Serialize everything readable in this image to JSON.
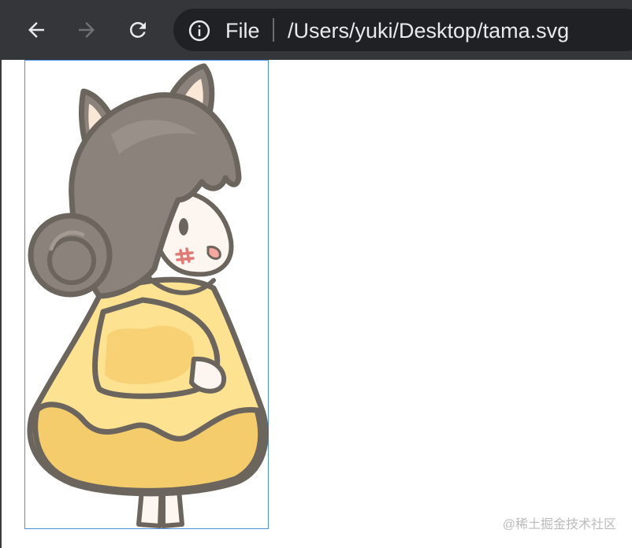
{
  "browser": {
    "back_icon": "arrow-left-icon",
    "forward_icon": "arrow-right-icon",
    "reload_icon": "reload-icon",
    "info_icon": "info-circle-icon",
    "scheme_label": "File",
    "url": "/Users/yuki/Desktop/tama.svg"
  },
  "content": {
    "image_name": "tama.svg"
  },
  "watermark": "@稀土掘金技术社区",
  "colors": {
    "toolbar_bg": "#35363a",
    "omnibox_bg": "#202124",
    "text": "#e8eaed",
    "frame_border": "#4a8fe0",
    "hair": "#8a827b",
    "outline": "#6b655e",
    "dress": "#fde391",
    "dress_shade": "#f5cc6b",
    "skin": "#fdf5ef",
    "ear_inner": "#fbe7d6",
    "cheek_mark": "#e07a74"
  }
}
